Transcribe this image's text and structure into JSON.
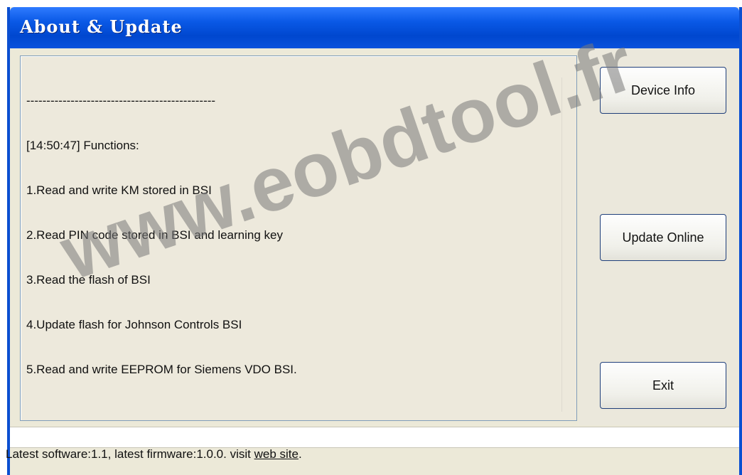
{
  "window": {
    "title": "About & Update"
  },
  "log": {
    "lines": [
      "-----------------------------------------------",
      "[14:50:47] Functions:",
      "1.Read and write KM stored in BSI",
      "2.Read PIN code stored in BSI and learning key",
      "3.Read the flash of BSI",
      "4.Update flash for Johnson Controls BSI",
      "5.Read and write EEPROM for Siemens VDO BSI."
    ]
  },
  "buttons": {
    "device_info": "Device Info",
    "update_online": "Update Online",
    "exit": "Exit"
  },
  "status_field": {
    "value": ""
  },
  "footer": {
    "text": "Latest software:1.1, latest firmware:1.0.0. visit ",
    "link": "web site",
    "suffix": "."
  },
  "watermark": {
    "text": "www.eobdtool.fr"
  }
}
